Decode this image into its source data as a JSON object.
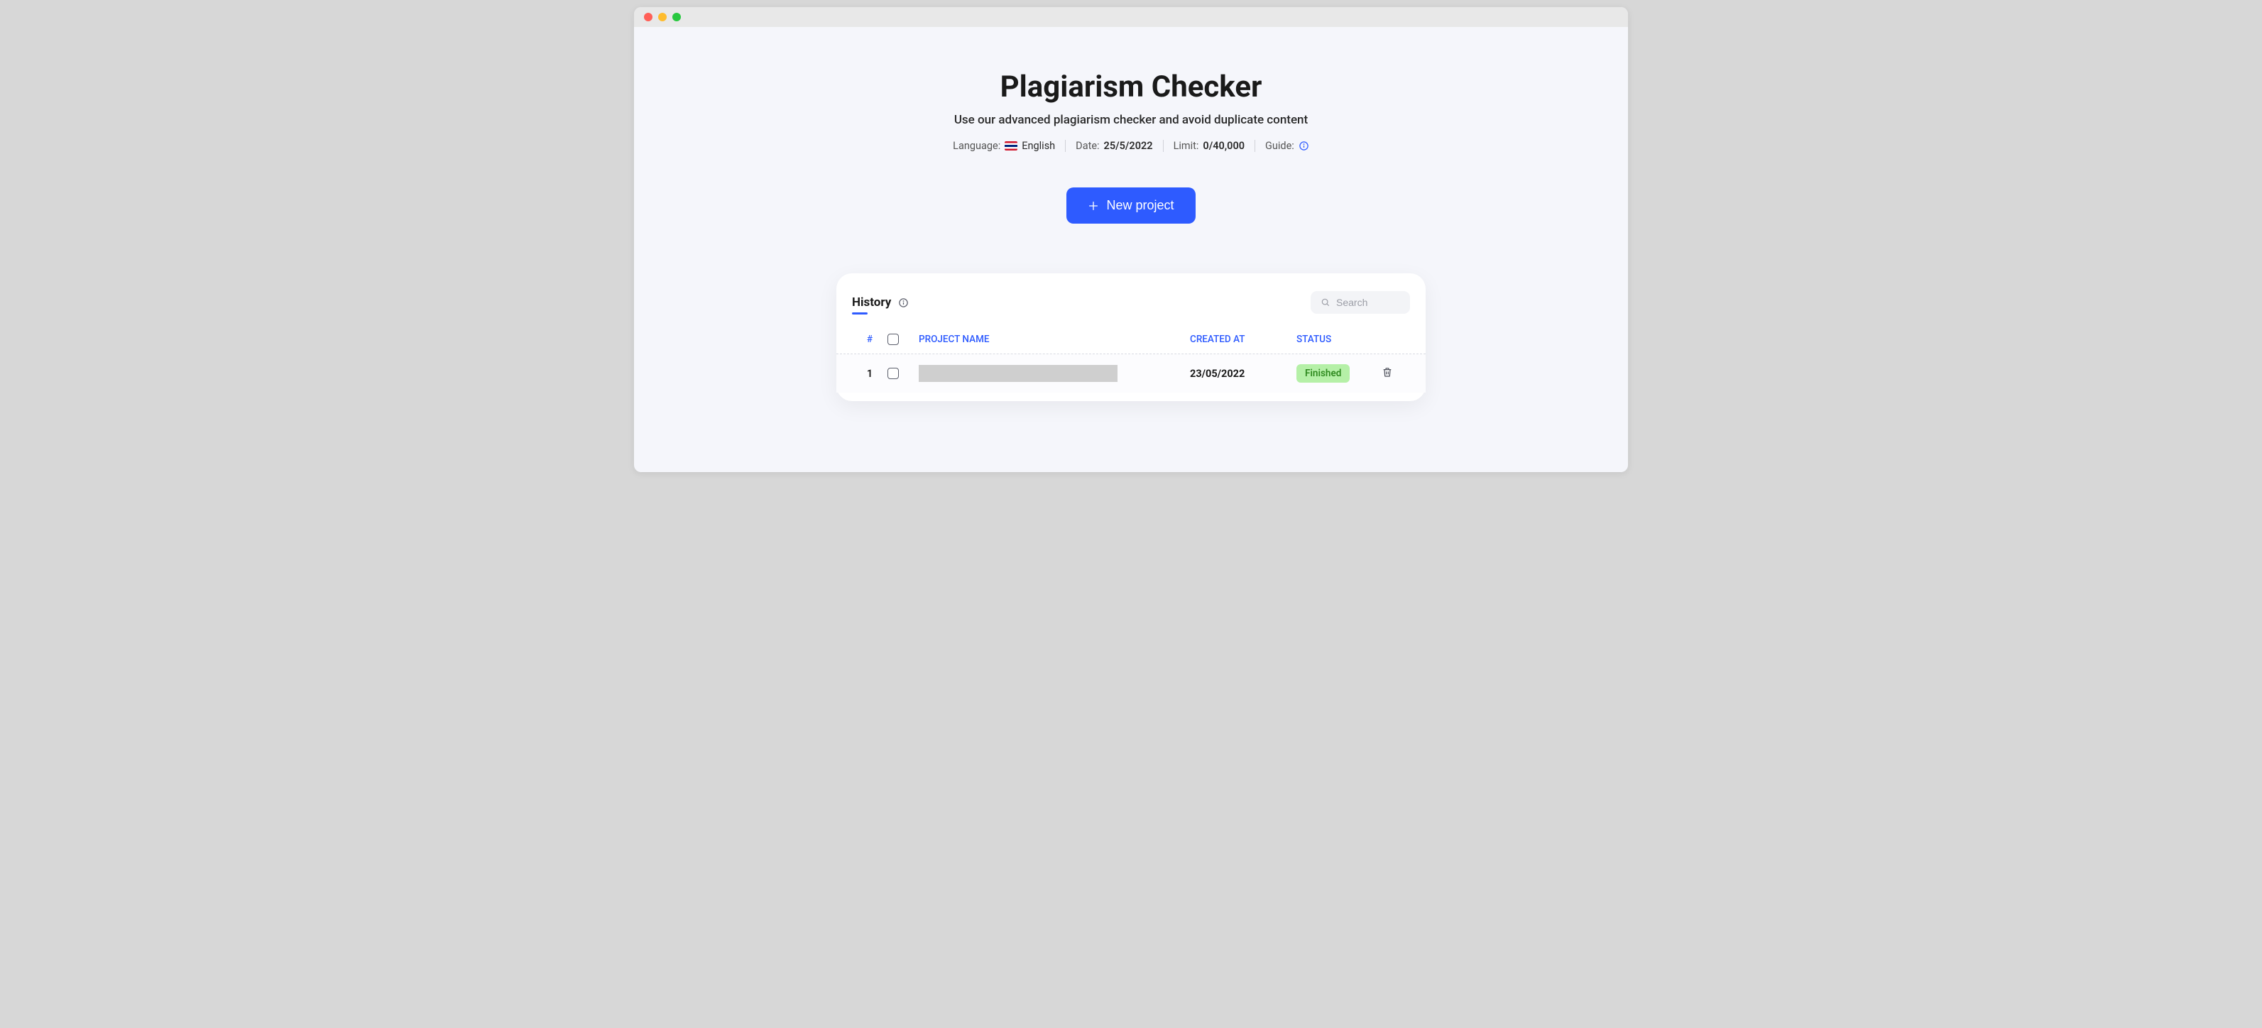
{
  "header": {
    "title": "Plagiarism Checker",
    "subtitle": "Use our advanced plagiarism checker and avoid duplicate content",
    "meta": {
      "language_label": "Language:",
      "language_value": "English",
      "date_label": "Date:",
      "date_value": "25/5/2022",
      "limit_label": "Limit:",
      "limit_value": "0/40,000",
      "guide_label": "Guide:"
    }
  },
  "new_project_button": "New project",
  "history": {
    "title": "History",
    "search_placeholder": "Search",
    "columns": {
      "index": "#",
      "name": "PROJECT NAME",
      "created": "CREATED AT",
      "status": "STATUS"
    },
    "rows": [
      {
        "index": "1",
        "created": "23/05/2022",
        "status": "Finished"
      }
    ]
  },
  "colors": {
    "accent": "#2e5bff",
    "status_finished_bg": "#b5f0a7",
    "status_finished_text": "#2f8a1f"
  }
}
